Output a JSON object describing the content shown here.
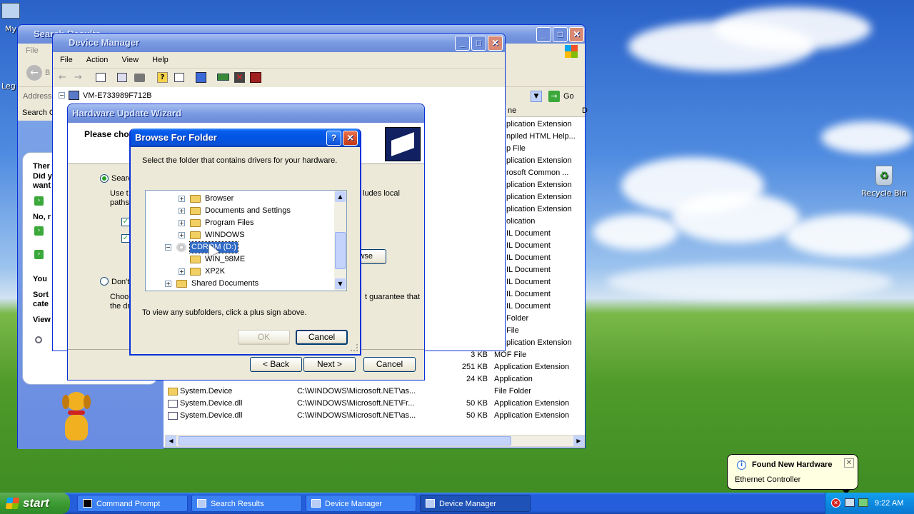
{
  "desktop": {
    "icon_left_top": "My",
    "icon_left_mid": "Leg",
    "recycle_bin": "Recycle Bin"
  },
  "search_window": {
    "title": "Search Results",
    "menu": [
      "File"
    ],
    "back": "B",
    "address_label": "Address",
    "go": "Go",
    "search_label": "Search C",
    "companion_lines": [
      "Ther",
      "Did y",
      "want",
      "No, r",
      "You",
      "Sort",
      "cate",
      "View"
    ],
    "column_header_name": "ne",
    "type_column": [
      "plication Extension",
      "npiled HTML Help...",
      "p File",
      "plication Extension",
      "rosoft Common ...",
      "plication Extension",
      "plication Extension",
      "plication Extension",
      "olication",
      "IL Document",
      "IL Document",
      "IL Document",
      "IL Document",
      "IL Document",
      "IL Document",
      "IL Document",
      "Folder",
      "File",
      "plication Extension"
    ],
    "rows": [
      {
        "name": "",
        "folder": "",
        "size": "3 KB",
        "type": "MOF File"
      },
      {
        "name": "",
        "folder": "",
        "size": "251 KB",
        "type": "Application Extension"
      },
      {
        "name": "",
        "folder": "",
        "size": "24 KB",
        "type": "Application"
      },
      {
        "name": "System.Device",
        "folder": "C:\\WINDOWS\\Microsoft.NET\\as...",
        "size": "",
        "type": "File Folder"
      },
      {
        "name": "System.Device.dll",
        "folder": "C:\\WINDOWS\\Microsoft.NET\\Fr...",
        "size": "50 KB",
        "type": "Application Extension"
      },
      {
        "name": "System.Device.dll",
        "folder": "C:\\WINDOWS\\Microsoft.NET\\as...",
        "size": "50 KB",
        "type": "Application Extension"
      }
    ]
  },
  "device_manager": {
    "title": "Device Manager",
    "menu": [
      "File",
      "Action",
      "View",
      "Help"
    ],
    "tree_root": "VM-E733989F712B"
  },
  "wizard": {
    "title": "Hardware Update Wizard",
    "heading": "Please cho",
    "radio_search": "Searc",
    "use_text_1": "Use t",
    "use_text_2": "paths",
    "includes_local": "ludes local",
    "browse_btn": "wse",
    "radio_dont": "Don't",
    "choose_1": "Choo",
    "choose_2": "the dr",
    "guarantee": "t guarantee that",
    "back_btn": "< Back",
    "next_btn": "Next >",
    "cancel_btn": "Cancel"
  },
  "browse": {
    "title": "Browse For Folder",
    "instruction": "Select the folder that contains drivers for your hardware.",
    "tree": [
      {
        "label": "Browser",
        "level": 2,
        "expander": "+",
        "icon": "folder-icon",
        "selected": false
      },
      {
        "label": "Documents and Settings",
        "level": 2,
        "expander": "+",
        "icon": "folder-icon",
        "selected": false
      },
      {
        "label": "Program Files",
        "level": 2,
        "expander": "+",
        "icon": "folder-icon",
        "selected": false
      },
      {
        "label": "WINDOWS",
        "level": 2,
        "expander": "+",
        "icon": "folder-icon",
        "selected": false
      },
      {
        "label": "CDROM (D:)",
        "level": 1,
        "expander": "−",
        "icon": "cdrom-icon",
        "selected": true
      },
      {
        "label": "WIN_98ME",
        "level": 2,
        "expander": "",
        "icon": "folder-icon",
        "selected": false
      },
      {
        "label": "XP2K",
        "level": 2,
        "expander": "+",
        "icon": "folder-icon",
        "selected": false
      },
      {
        "label": "Shared Documents",
        "level": 1,
        "expander": "+",
        "icon": "folder-icon",
        "selected": false
      }
    ],
    "hint": "To view any subfolders, click a plus sign above.",
    "ok": "OK",
    "cancel": "Cancel"
  },
  "balloon": {
    "title": "Found New Hardware",
    "body": "Ethernet Controller"
  },
  "taskbar": {
    "start": "start",
    "tasks": [
      {
        "label": "Command Prompt",
        "icon": "cmd-icon",
        "active": false
      },
      {
        "label": "Search Results",
        "icon": "search-results-icon",
        "active": false
      },
      {
        "label": "Device Manager",
        "icon": "device-manager-icon",
        "active": false
      },
      {
        "label": "Device Manager",
        "icon": "device-manager-icon",
        "active": true
      }
    ],
    "clock": "9:22 AM"
  }
}
